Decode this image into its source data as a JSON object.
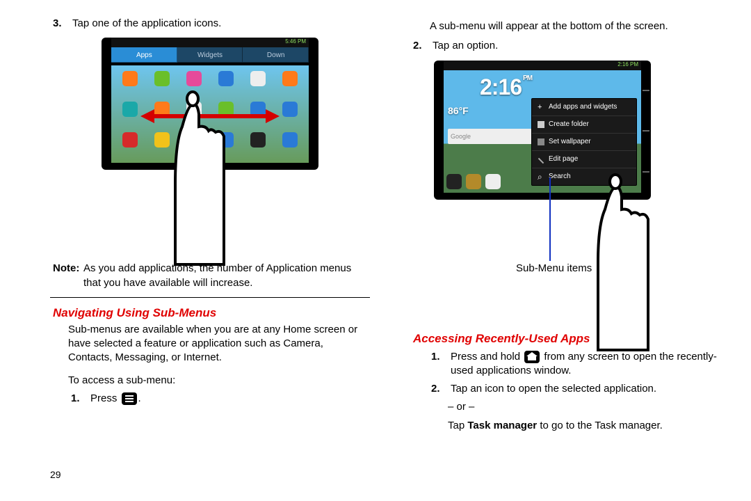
{
  "page_number": "29",
  "left": {
    "step3_num": "3.",
    "step3_text": "Tap one of the application icons.",
    "note_label": "Note:",
    "note_text": "As you add applications, the number of Application menus that you have available will increase.",
    "heading": "Navigating Using Sub-Menus",
    "para": "Sub-menus are available when you are at any Home screen or have selected a feature or application such as Camera, Contacts, Messaging, or Internet.",
    "access_line": "To access a sub-menu:",
    "step1_num": "1.",
    "step1_text_a": "Press",
    "step1_text_b": ".",
    "mock": {
      "status_time": "5:46 PM",
      "tab_apps": "Apps",
      "tab_widgets": "Widgets",
      "tab_down": "Down"
    }
  },
  "right": {
    "lead": "A sub-menu will appear at the bottom of the screen.",
    "step2_num": "2.",
    "step2_text": "Tap an option.",
    "callout": "Sub-Menu items",
    "heading": "Accessing Recently-Used Apps",
    "step1_num": "1.",
    "step1_a": "Press and hold",
    "step1_b": "from any screen to open the recently-used applications window.",
    "step2b_num": "2.",
    "step2b_text": "Tap an icon to open the selected application.",
    "or": "– or –",
    "tap_tm_a": "Tap",
    "tap_tm_b": "Task manager",
    "tap_tm_c": "to go to the Task manager.",
    "mock": {
      "status_time": "2:16 PM",
      "clock": "2:16",
      "ampm": "PM",
      "temp": "86°F",
      "search": "Google",
      "menu_items": [
        "Add apps and widgets",
        "Create folder",
        "Set wallpaper",
        "Edit page",
        "Search"
      ]
    }
  }
}
